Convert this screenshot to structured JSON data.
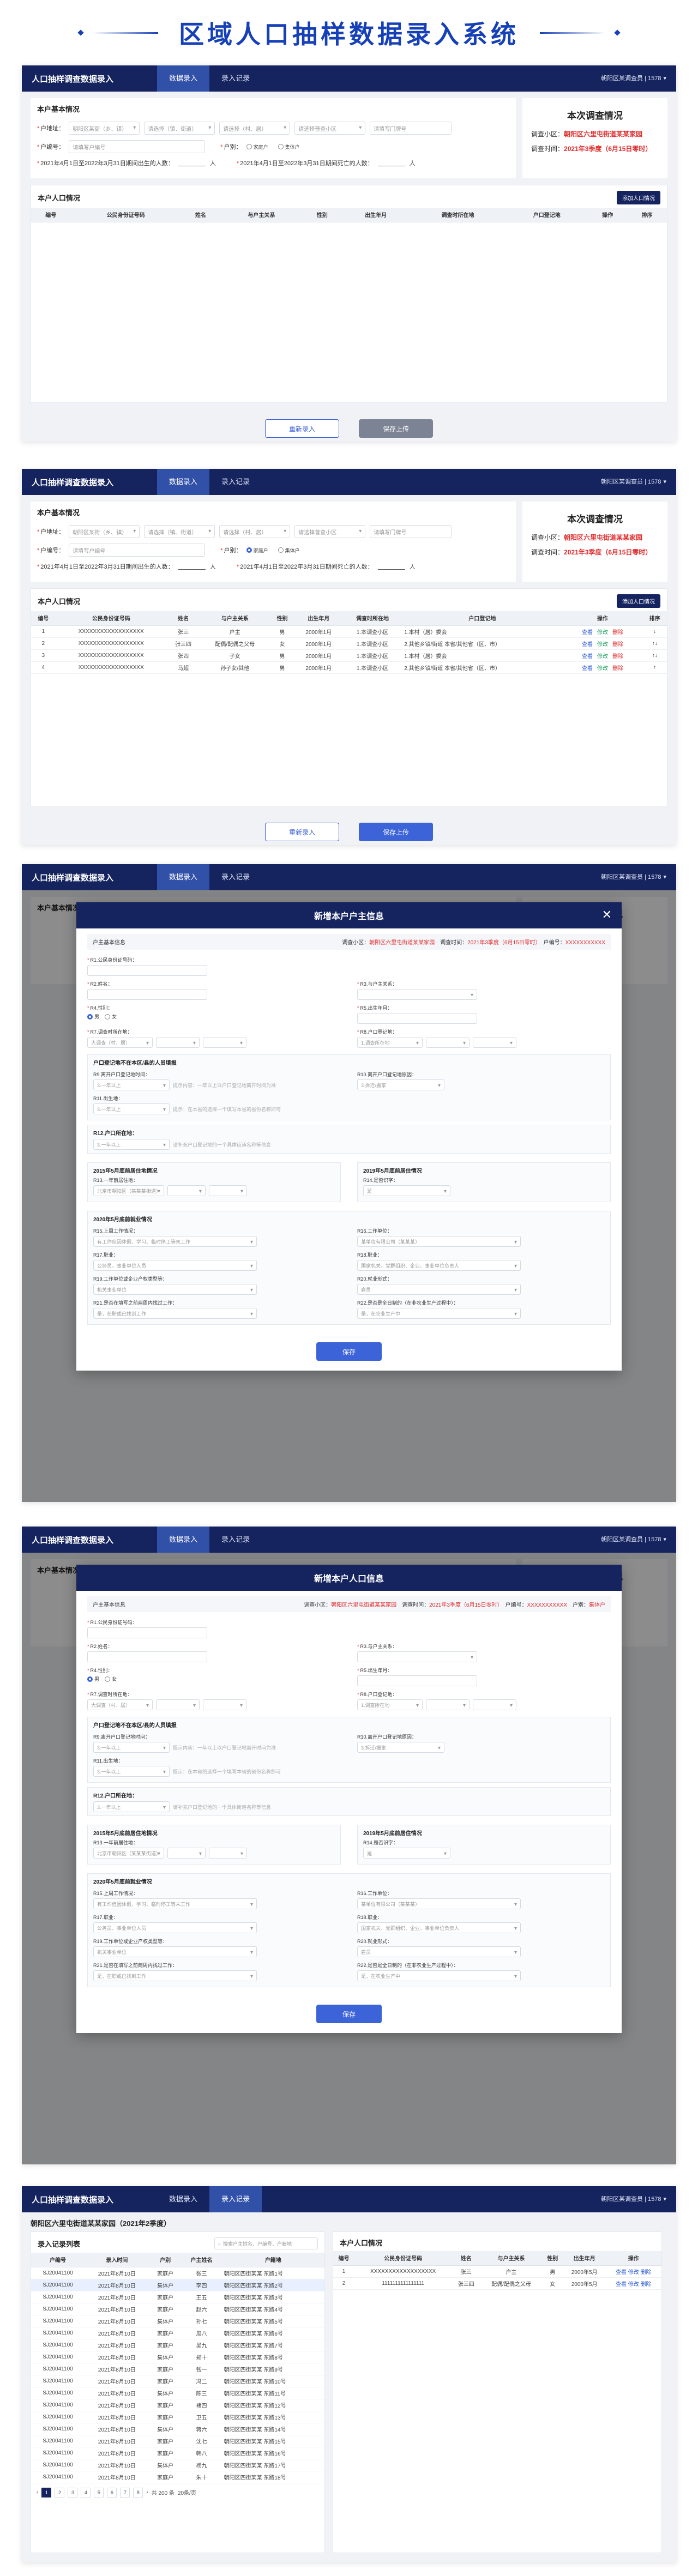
{
  "hero": {
    "title": "区域人口抽样数据录入系统"
  },
  "app": {
    "title": "人口抽样调查数据录入",
    "tab_entry": "数据录入",
    "tab_records": "录入记录",
    "user": "朝阳区某调查员 | 1578"
  },
  "basic": {
    "section_title": "本户基本情况",
    "addr_label": "户地址：",
    "sel1": "朝阳区某街（乡、镇）",
    "sel2": "请选择（镇、街道）",
    "sel3": "请选择（村、居）",
    "sel4": "请选择普查小区",
    "addr_placeholder": "请填写门牌号",
    "code_label": "户编号：",
    "code_placeholder": "请填写户编号",
    "type_label": "户别：",
    "type_value": "家庭户",
    "type_value2": "集体户",
    "births_label": "2021年4月1日至2022年3月31日期间出生的人数：",
    "deaths_label": "2021年4月1日至2022年3月31日期间死亡的人数：",
    "unit": "人"
  },
  "survey": {
    "title": "本次调查情况",
    "area_label": "调查小区：",
    "area_value": "朝阳区六里屯街道某某家园",
    "time_label": "调查时间：",
    "time_value": "2021年3季度（6月15日零时）"
  },
  "members": {
    "section_title": "本户人口情况",
    "add_button": "添加人口情况",
    "headers": [
      "编号",
      "公民身份证号码",
      "姓名",
      "与户主关系",
      "性别",
      "出生年月",
      "调查时所在地",
      "户口登记地",
      "操作",
      "排序"
    ],
    "rows": [
      {
        "no": "1",
        "id": "XXXXXXXXXXXXXXXXXX",
        "name": "张三",
        "rel": "户主",
        "sex": "男",
        "birth": "2000年1月",
        "loc": "1.本调查小区",
        "reg": "1.本村（居）委会",
        "ops": [
          "查看",
          "修改",
          "删除"
        ],
        "sort": "↓"
      },
      {
        "no": "2",
        "id": "XXXXXXXXXXXXXXXXXX",
        "name": "张三四",
        "rel": "配偶/配偶之父母",
        "sex": "女",
        "birth": "2000年1月",
        "loc": "1.本调查小区",
        "reg": "2.其他乡镇/街道 本省/其他省（区、市）",
        "ops": [
          "查看",
          "修改",
          "删除"
        ],
        "sort": "↑↓"
      },
      {
        "no": "3",
        "id": "XXXXXXXXXXXXXXXXXX",
        "name": "张四",
        "rel": "子女",
        "sex": "男",
        "birth": "2000年1月",
        "loc": "1.本调查小区",
        "reg": "1.本村（居）委会",
        "ops": [
          "查看",
          "修改",
          "删除"
        ],
        "sort": "↑↓"
      },
      {
        "no": "4",
        "id": "XXXXXXXXXXXXXXXXXX",
        "name": "马超",
        "rel": "孙子女/其他",
        "sex": "男",
        "birth": "2000年1月",
        "loc": "1.本调查小区",
        "reg": "2.其他乡镇/街道 本省/其他省（区、市）",
        "ops": [
          "查看",
          "修改",
          "删除"
        ],
        "sort": "↑"
      }
    ]
  },
  "actions": {
    "reset": "重新录入",
    "save": "保存上传"
  },
  "modal1": {
    "title": "新增本户户主信息",
    "save": "保存"
  },
  "modal2": {
    "title": "新增本户人口信息",
    "save": "保存"
  },
  "modal": {
    "info_left": "户主基本信息",
    "info_area_label": "调查小区：",
    "info_area": "朝阳区六里屯街道某某家园",
    "info_time_label": "调查时间：",
    "info_time": "2021年3季度（6月15日零时）",
    "info_code_label": "户编号：",
    "info_code": "XXXXXXXXXXX",
    "info_type_label": "户别：",
    "info_type": "集体户",
    "f_id": "R1.公民身份证号码：",
    "f_name": "R2.姓名：",
    "f_rel": "R3.与户主关系：",
    "f_sex": "R4.性别：",
    "male": "男",
    "female": "女",
    "f_birth": "R5.出生年月：",
    "f_nation": "R6.民族：",
    "f_loc": "R7.调查时所在地：",
    "f_loc_val": "大调查（村、居）",
    "f_reg": "R8.户口登记地：",
    "f_reg_val": "1.调查所在地",
    "grp_mig": "户口登记地不在本区/县的人员填报",
    "f_leave_time": "R9.离开户口登记地时间：",
    "f_leave_val": "3.一年以上",
    "f_leave_hint": "提示内容：一年以上以户口登记地离开时间为准",
    "f_leave_reason": "R10.离开户口登记地原因：",
    "f_leave_reason_val": "3.拆迁/搬家",
    "f_native": "R11.出生地：",
    "f_native_val": "3.一年以上",
    "f_native_hint": "提示：在本省的选择一个填写本省的省份名称即可",
    "grp_reg": "R12.户口所在地：",
    "f_reg_hint": "请补充户口登记地的一个具体街道名称等信息",
    "grp_2015": "2015年5月底前居住地情况",
    "grp_2019": "2019年5月底前居住情况",
    "f_2015": "R13.一年前居住地：",
    "f_2015_val": "北京市朝阳区（某某某街道）",
    "f_2019": "R14.是否识字：",
    "f_2019_val": "是",
    "grp_2020": "2020年5月底前就业情况",
    "f_work1": "R15.上周工作情况：",
    "f_work1_val": "有工作但因休假、学习、临时停工等未工作",
    "f_work2": "R16.工作单位：",
    "f_work2_val": "某单位有限公司（某某某）",
    "f_work3": "R17.职业：",
    "f_work3_val": "公务员、事业单位人员",
    "f_work4": "R18.职业：",
    "f_work4_val": "国家机关、党群组织、企业、事业单位负责人",
    "f_work5": "R19.工作单位或企业产权类型等：",
    "f_work5_val": "机关事业单位",
    "f_work6": "R20.就业形式：",
    "f_work6_val": "雇员",
    "f_work7": "R21.是否在填写之前两周内找过工作：",
    "f_work7_val": "是，在职或已找到工作",
    "f_work8": "R22.是否是全日制的（在非农业生产过程中）：",
    "f_work8_val": "是，在农业生产中"
  },
  "p5": {
    "title": "朝阳区六里屯街道某某家园（2021年2季度）",
    "left_title": "录入记录列表",
    "search_placeholder": "搜索户主姓名、户编号、户籍地",
    "left_headers": [
      "户编号",
      "录入时间",
      "户别",
      "户主姓名",
      "户籍地"
    ],
    "left_rows": [
      [
        "SJ20041100",
        "2021年8月10日",
        "家庭户",
        "张三",
        "朝阳区四街某某 东路1号"
      ],
      [
        "SJ20041100",
        "2021年8月10日",
        "集体户",
        "李四",
        "朝阳区四街某某 东路2号"
      ],
      [
        "SJ20041100",
        "2021年8月10日",
        "家庭户",
        "王五",
        "朝阳区四街某某 东路3号"
      ],
      [
        "SJ20041100",
        "2021年8月10日",
        "家庭户",
        "赵六",
        "朝阳区四街某某 东路4号"
      ],
      [
        "SJ20041100",
        "2021年8月10日",
        "集体户",
        "孙七",
        "朝阳区四街某某 东路5号"
      ],
      [
        "SJ20041100",
        "2021年8月10日",
        "家庭户",
        "周八",
        "朝阳区四街某某 东路6号"
      ],
      [
        "SJ20041100",
        "2021年8月10日",
        "家庭户",
        "吴九",
        "朝阳区四街某某 东路7号"
      ],
      [
        "SJ20041100",
        "2021年8月10日",
        "集体户",
        "郑十",
        "朝阳区四街某某 东路8号"
      ],
      [
        "SJ20041100",
        "2021年8月10日",
        "家庭户",
        "钱一",
        "朝阳区四街某某 东路9号"
      ],
      [
        "SJ20041100",
        "2021年8月10日",
        "家庭户",
        "冯二",
        "朝阳区四街某某 东路10号"
      ],
      [
        "SJ20041100",
        "2021年8月10日",
        "集体户",
        "陈三",
        "朝阳区四街某某 东路11号"
      ],
      [
        "SJ20041100",
        "2021年8月10日",
        "家庭户",
        "褚四",
        "朝阳区四街某某 东路12号"
      ],
      [
        "SJ20041100",
        "2021年8月10日",
        "家庭户",
        "卫五",
        "朝阳区四街某某 东路13号"
      ],
      [
        "SJ20041100",
        "2021年8月10日",
        "集体户",
        "蒋六",
        "朝阳区四街某某 东路14号"
      ],
      [
        "SJ20041100",
        "2021年8月10日",
        "家庭户",
        "沈七",
        "朝阳区四街某某 东路15号"
      ],
      [
        "SJ20041100",
        "2021年8月10日",
        "家庭户",
        "韩八",
        "朝阳区四街某某 东路16号"
      ],
      [
        "SJ20041100",
        "2021年8月10日",
        "集体户",
        "杨九",
        "朝阳区四街某某 东路17号"
      ],
      [
        "SJ20041100",
        "2021年8月10日",
        "家庭户",
        "朱十",
        "朝阳区四街某某 东路18号"
      ]
    ],
    "right_title": "本户人口情况",
    "right_headers": [
      "编号",
      "公民身份证号码",
      "姓名",
      "与户主关系",
      "性别",
      "出生年月",
      "操作"
    ],
    "right_rows": [
      [
        "1",
        "XXXXXXXXXXXXXXXXXX",
        "张三",
        "户主",
        "男",
        "2000年5月",
        "查看 修改 删除"
      ],
      [
        "2",
        "1111111111111111",
        "张三四",
        "配偶/配偶之父母",
        "女",
        "2000年5月",
        "查看 修改 删除"
      ]
    ],
    "pages": [
      "1",
      "2",
      "3",
      "4",
      "5",
      "6",
      "7",
      "8"
    ],
    "total": "共 200 条",
    "per_page": "20条/页"
  }
}
